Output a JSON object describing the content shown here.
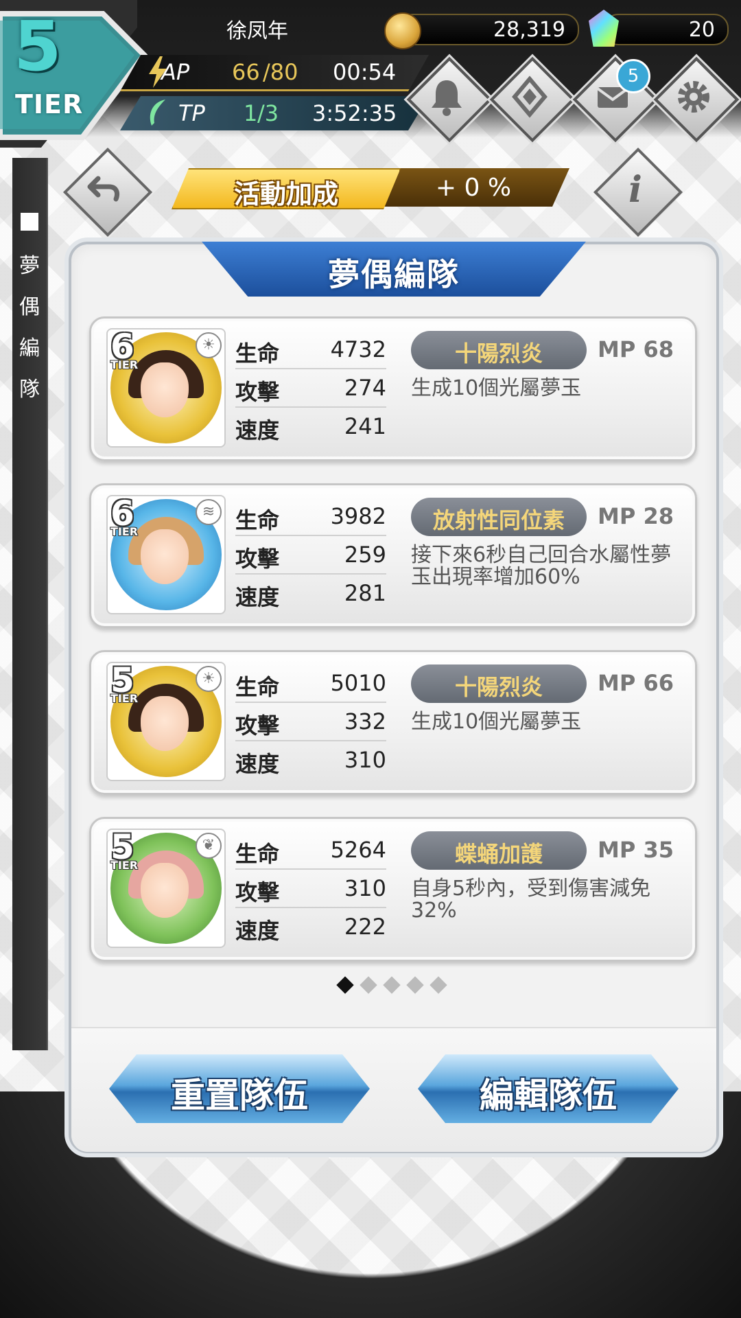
{
  "player": {
    "name": "徐凤年",
    "tier_number": "5",
    "tier_label": "TIER"
  },
  "currency": {
    "coins": "28,319",
    "gems": "20"
  },
  "ap": {
    "label": "AP",
    "current": "66",
    "max": "/80",
    "timer": "00:54"
  },
  "tp": {
    "label": "TP",
    "current": "1",
    "max": "/3",
    "timer": "3:52:35"
  },
  "mail_badge": "5",
  "side_tab": {
    "label_1": "夢",
    "label_2": "偶",
    "label_3": "編",
    "label_4": "隊"
  },
  "event_bonus": {
    "label": "活動加成",
    "value": "+ 0 %"
  },
  "panel": {
    "title": "夢偶編隊"
  },
  "stat_labels": {
    "hp": "生命",
    "atk": "攻擊",
    "spd": "速度"
  },
  "team": [
    {
      "tier": "6",
      "tier_label": "TIER",
      "element": "light",
      "hp": "4732",
      "atk": "274",
      "spd": "241",
      "skill": "十陽烈炎",
      "mp": "MP 68",
      "desc": "生成10個光屬夢玉"
    },
    {
      "tier": "6",
      "tier_label": "TIER",
      "element": "water",
      "hp": "3982",
      "atk": "259",
      "spd": "281",
      "skill": "放射性同位素",
      "mp": "MP 28",
      "desc": "接下來6秒自己回合水屬性夢玉出現率增加60%"
    },
    {
      "tier": "5",
      "tier_label": "TIER",
      "element": "light",
      "hp": "5010",
      "atk": "332",
      "spd": "310",
      "skill": "十陽烈炎",
      "mp": "MP 66",
      "desc": "生成10個光屬夢玉"
    },
    {
      "tier": "5",
      "tier_label": "TIER",
      "element": "wood",
      "hp": "5264",
      "atk": "310",
      "spd": "222",
      "skill": "蝶蛹加護",
      "mp": "MP 35",
      "desc": "自身5秒內，受到傷害減免32%"
    }
  ],
  "pagination": {
    "total": 5,
    "active": 1
  },
  "buttons": {
    "reset": "重置隊伍",
    "edit": "編輯隊伍"
  }
}
